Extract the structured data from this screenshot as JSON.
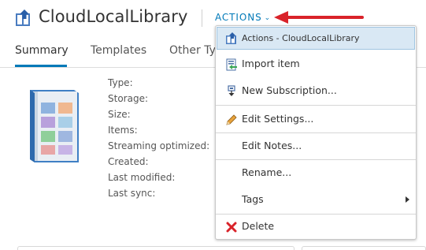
{
  "header": {
    "title": "CloudLocalLibrary",
    "actions_label": "ACTIONS",
    "actions_caret": "⌄"
  },
  "tabs": [
    {
      "label": "Summary",
      "active": true
    },
    {
      "label": "Templates",
      "active": false
    },
    {
      "label": "Other Ty",
      "active": false
    }
  ],
  "properties": [
    {
      "label": "Type:"
    },
    {
      "label": "Storage:"
    },
    {
      "label": "Size:"
    },
    {
      "label": "Items:"
    },
    {
      "label": "Streaming optimized:"
    },
    {
      "label": "Created:"
    },
    {
      "label": "Last modified:"
    },
    {
      "label": "Last sync:"
    }
  ],
  "menu": {
    "header": "Actions - CloudLocalLibrary",
    "items": [
      {
        "label": "Import item",
        "icon": "import-icon"
      },
      {
        "label": "New Subscription...",
        "icon": "subscription-icon"
      },
      {
        "label": "Edit Settings...",
        "icon": "pencil-icon"
      },
      {
        "label": "Edit Notes...",
        "icon": ""
      },
      {
        "label": "Rename...",
        "icon": ""
      },
      {
        "label": "Tags",
        "icon": "",
        "submenu": true
      },
      {
        "label": "Delete",
        "icon": "delete-icon"
      }
    ]
  },
  "colors": {
    "accent": "#0079b8",
    "annotation_arrow": "#d9232a",
    "menu_header_bg": "#d9e8f4",
    "delete": "#d9232a",
    "pencil": "#e8a33c"
  }
}
